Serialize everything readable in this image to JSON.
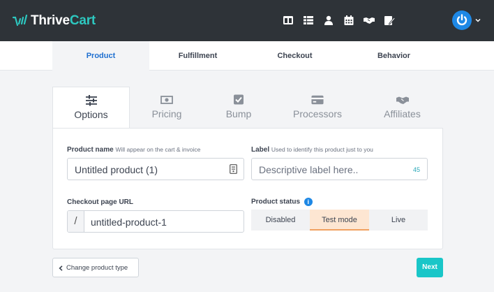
{
  "app": {
    "brand_part1": "Thrive",
    "brand_part2": "Cart",
    "brand_color_primary": "#2dc8c0",
    "topbar_color": "#2e3338"
  },
  "topnav": {
    "icons": [
      "layout-icon",
      "list-icon",
      "user-icon",
      "calendar-icon",
      "handshake-icon",
      "edit-icon"
    ],
    "avatar_icon": "power-icon"
  },
  "main_tabs": [
    {
      "label": "Product",
      "active": true
    },
    {
      "label": "Fulfillment",
      "active": false
    },
    {
      "label": "Checkout",
      "active": false
    },
    {
      "label": "Behavior",
      "active": false
    }
  ],
  "sub_tabs": [
    {
      "label": "Options",
      "icon": "sliders-icon",
      "active": true
    },
    {
      "label": "Pricing",
      "icon": "money-icon",
      "active": false
    },
    {
      "label": "Bump",
      "icon": "checkbox-icon",
      "active": false
    },
    {
      "label": "Processors",
      "icon": "credit-card-icon",
      "active": false
    },
    {
      "label": "Affiliates",
      "icon": "handshake-icon",
      "active": false
    }
  ],
  "form": {
    "product_name": {
      "label": "Product name",
      "hint": "Will appear on the cart & invoice",
      "value": "Untitled product (1)"
    },
    "label_field": {
      "label": "Label",
      "hint": "Used to identify this product just to you",
      "placeholder": "Descriptive label here..",
      "counter": "45"
    },
    "checkout_url": {
      "label": "Checkout page URL",
      "prefix": "/",
      "value": "untitled-product-1"
    },
    "product_status": {
      "label": "Product status",
      "info": "i",
      "options": [
        "Disabled",
        "Test mode",
        "Live"
      ],
      "selected": "Test mode"
    }
  },
  "footer": {
    "back_label": "Change product type",
    "next_label": "Next",
    "next_color": "#19c6c8"
  }
}
